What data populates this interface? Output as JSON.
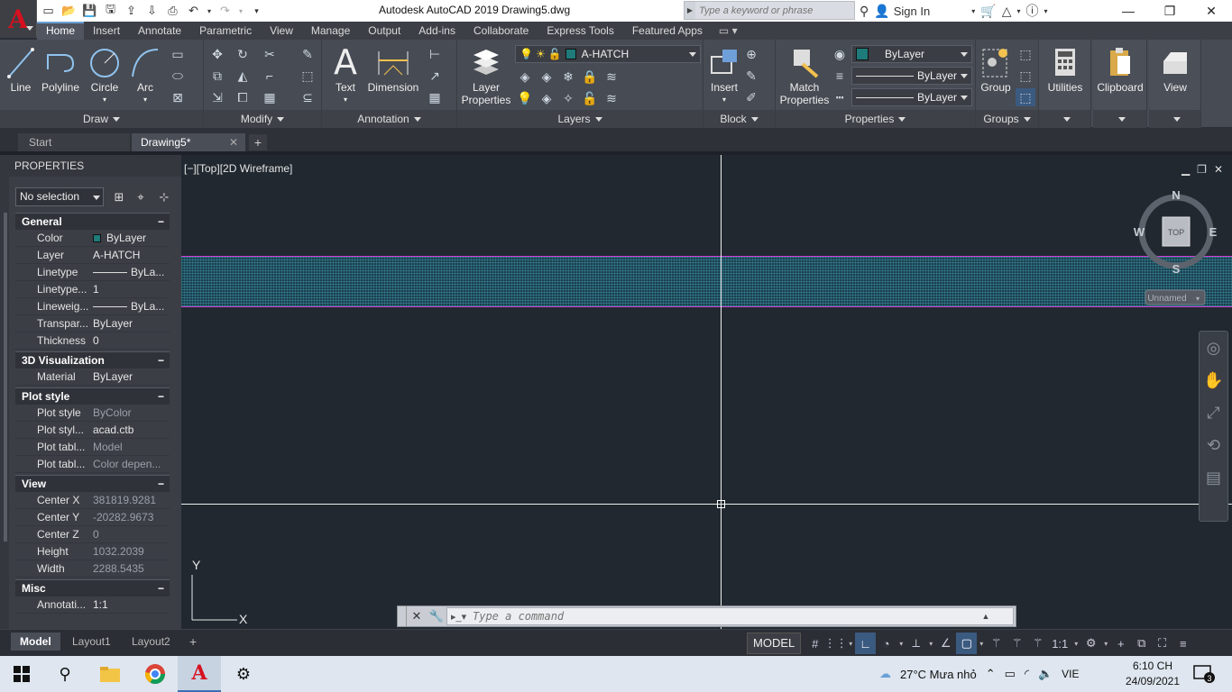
{
  "titlebar": {
    "title": "Autodesk AutoCAD 2019    Drawing5.dwg",
    "search_placeholder": "Type a keyword or phrase",
    "signin_label": "Sign In"
  },
  "ribbon_tabs": [
    "Home",
    "Insert",
    "Annotate",
    "Parametric",
    "View",
    "Manage",
    "Output",
    "Add-ins",
    "Collaborate",
    "Express Tools",
    "Featured Apps"
  ],
  "ribbon": {
    "draw": {
      "title": "Draw",
      "tools": [
        "Line",
        "Polyline",
        "Circle",
        "Arc"
      ]
    },
    "modify": {
      "title": "Modify"
    },
    "annotation": {
      "title": "Annotation",
      "tools": [
        "Text",
        "Dimension"
      ]
    },
    "layers": {
      "title": "Layers",
      "layer_props_1": "Layer",
      "layer_props_2": "Properties",
      "current_layer": "A-HATCH"
    },
    "block": {
      "title": "Block",
      "insert": "Insert"
    },
    "properties": {
      "title": "Properties",
      "match_1": "Match",
      "match_2": "Properties",
      "color": "ByLayer",
      "linetype": "ByLayer",
      "lineweight": "ByLayer"
    },
    "groups": {
      "title": "Groups",
      "group": "Group"
    },
    "utilities": "Utilities",
    "clipboard": "Clipboard",
    "view": "View"
  },
  "file_tabs": {
    "start": "Start",
    "drawing": "Drawing5*"
  },
  "properties": {
    "title": "PROPERTIES",
    "selection": "No selection",
    "sections": [
      {
        "name": "General",
        "rows": [
          {
            "key": "Color",
            "value": "ByLayer"
          },
          {
            "key": "Layer",
            "value": "A-HATCH"
          },
          {
            "key": "Linetype",
            "value": "ByLa..."
          },
          {
            "key": "Linetype...",
            "value": "1"
          },
          {
            "key": "Lineweig...",
            "value": "ByLa..."
          },
          {
            "key": "Transpar...",
            "value": "ByLayer"
          },
          {
            "key": "Thickness",
            "value": "0"
          }
        ]
      },
      {
        "name": "3D Visualization",
        "rows": [
          {
            "key": "Material",
            "value": "ByLayer"
          }
        ]
      },
      {
        "name": "Plot style",
        "rows": [
          {
            "key": "Plot style",
            "value": "ByColor"
          },
          {
            "key": "Plot styl...",
            "value": "acad.ctb"
          },
          {
            "key": "Plot tabl...",
            "value": "Model"
          },
          {
            "key": "Plot tabl...",
            "value": "Color depen..."
          }
        ]
      },
      {
        "name": "View",
        "rows": [
          {
            "key": "Center X",
            "value": "381819.9281"
          },
          {
            "key": "Center Y",
            "value": "-20282.9673"
          },
          {
            "key": "Center Z",
            "value": "0"
          },
          {
            "key": "Height",
            "value": "1032.2039"
          },
          {
            "key": "Width",
            "value": "2288.5435"
          }
        ]
      },
      {
        "name": "Misc",
        "rows": [
          {
            "key": "Annotati...",
            "value": "1:1"
          }
        ]
      }
    ]
  },
  "viewport": {
    "label": "[−][Top][2D Wireframe]",
    "viewcube_face": "TOP",
    "compass": {
      "n": "N",
      "s": "S",
      "e": "E",
      "w": "W"
    },
    "ucs_name": "Unnamed",
    "ucs_x": "X",
    "ucs_y": "Y"
  },
  "command": {
    "placeholder": "Type a command"
  },
  "layout_tabs": [
    "Model",
    "Layout1",
    "Layout2"
  ],
  "status": {
    "model": "MODEL",
    "scale": "1:1"
  },
  "taskbar": {
    "weather": "27°C  Mưa nhỏ",
    "lang": "VIE",
    "time": "6:10 CH",
    "date": "24/09/2021",
    "notifications": "3"
  },
  "colors": {
    "hatch_boundary": "#d13fd6",
    "layer_swatch": "#1f7a7a",
    "canvas": "#212830"
  }
}
